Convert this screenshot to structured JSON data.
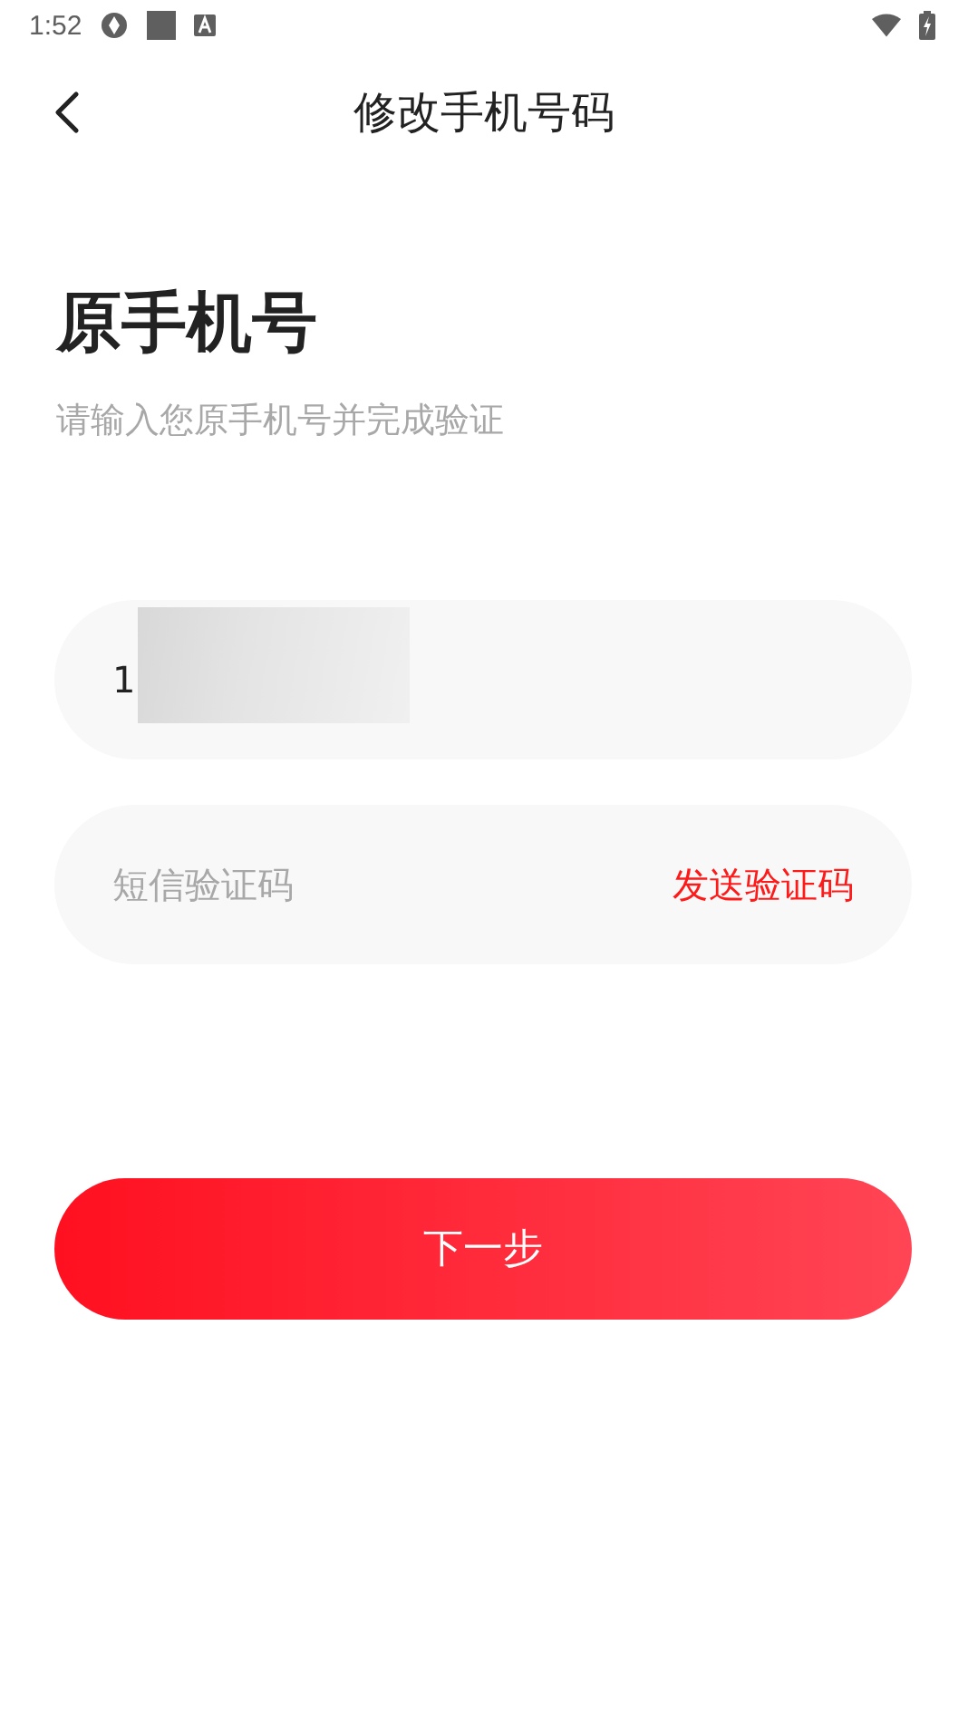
{
  "status_bar": {
    "time": "1:52"
  },
  "header": {
    "title": "修改手机号码"
  },
  "heading": "原手机号",
  "subtitle": "请输入您原手机号并完成验证",
  "phone_field": {
    "value": "1",
    "redacted": true
  },
  "code_field": {
    "placeholder": "短信验证码",
    "action": "发送验证码"
  },
  "next_button": {
    "label": "下一步"
  }
}
